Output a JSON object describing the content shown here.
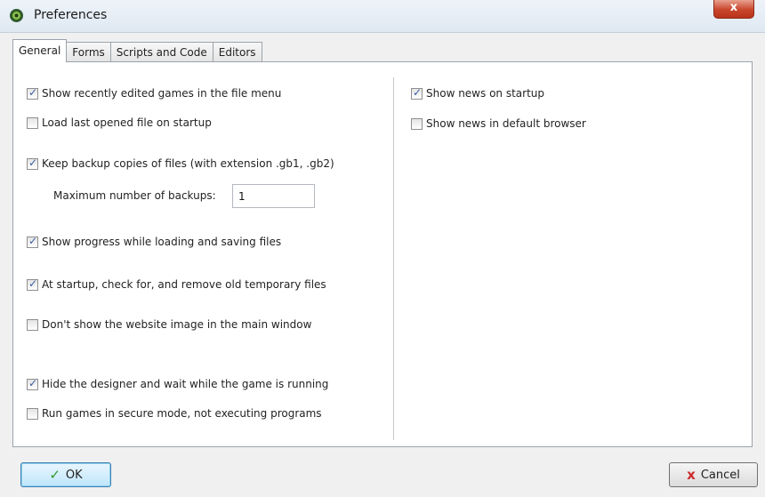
{
  "window": {
    "title": "Preferences",
    "close_symbol": "x"
  },
  "tabs": [
    {
      "label": "General",
      "active": true
    },
    {
      "label": "Forms",
      "active": false
    },
    {
      "label": "Scripts and Code",
      "active": false
    },
    {
      "label": "Editors",
      "active": false
    }
  ],
  "general": {
    "left_options": [
      {
        "label": "Show recently edited games in the file menu",
        "checked": true
      },
      {
        "label": "Load last opened file on startup",
        "checked": false
      },
      {
        "label": "Keep backup copies of files (with extension .gb1, .gb2)",
        "checked": true
      },
      {
        "label": "Show progress while loading and saving files",
        "checked": true
      },
      {
        "label": "At startup, check for, and remove old temporary files",
        "checked": true
      },
      {
        "label": "Don't show the website image in the main window",
        "checked": false
      },
      {
        "label": "Hide the designer and wait while the game is running",
        "checked": true
      },
      {
        "label": "Run games in secure mode, not executing programs",
        "checked": false
      }
    ],
    "right_options": [
      {
        "label": "Show news on startup",
        "checked": true
      },
      {
        "label": "Show news in default browser",
        "checked": false
      }
    ],
    "backups": {
      "label": "Maximum number of backups:",
      "value": "1"
    }
  },
  "buttons": {
    "ok_label": "OK",
    "cancel_label": "Cancel"
  },
  "check_mark": "✓",
  "icons": {
    "app": "gear-icon",
    "ok": "checkmark-icon",
    "cancel": "x-icon"
  },
  "colors": {
    "ok_icon": "#2f9a2f",
    "cancel_icon": "#cc2b2b",
    "close_button": "#c9462c"
  }
}
